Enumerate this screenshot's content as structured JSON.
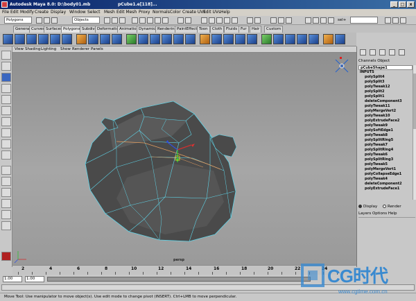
{
  "window": {
    "title": "Autodesk Maya 8.0: D:\\body01.mb",
    "subtitle": "pCube1.e[118]..."
  },
  "menubar": [
    "File",
    "Edit",
    "Modify",
    "Create",
    "Display",
    "Window",
    "Select",
    "Mesh",
    "Edit Mesh",
    "Proxy",
    "Normals",
    "Color",
    "Create UVs",
    "Edit UVs",
    "Help"
  ],
  "statusline": {
    "mode": "Polygons",
    "objects_label": "Objects",
    "sel_label": "sel+"
  },
  "shelf_tabs": [
    "General",
    "Curves",
    "Surfaces",
    "Polygons",
    "Subdivs",
    "Deformation",
    "Animation",
    "Dynamics",
    "Rendering",
    "PaintEffects",
    "Toon",
    "Cloth",
    "Fluids",
    "Fur",
    "Hair",
    "Custom"
  ],
  "active_shelf_tab": "Polygons",
  "panel_menu": [
    "View",
    "Shading",
    "Lighting",
    "Show",
    "Renderer",
    "Panels"
  ],
  "viewport": {
    "camera_label": "persp"
  },
  "channel_box": {
    "menu": "Channels  Object",
    "object": "pCubeShape1",
    "inputs_label": "INPUTS",
    "inputs": [
      "polySplit4",
      "polySplit3",
      "polyTweak12",
      "polySplit2",
      "polySplit1",
      "deleteComponent3",
      "polyTweak11",
      "polyMergeVert2",
      "polyTweak10",
      "polyExtrudeFace2",
      "polyTweak9",
      "polySoftEdge1",
      "polyTweak8",
      "polySplitRing5",
      "polyTweak7",
      "polySplitRing4",
      "polyTweak6",
      "polySplitRing3",
      "polyTweak5",
      "polyMergeVert1",
      "polyCollapseEdge1",
      "polyTweak4",
      "deleteComponent2",
      "polyExtrudeFace1"
    ],
    "layer_display": "Display",
    "layer_render": "Render",
    "layer_menu": "Layers  Options  Help"
  },
  "time_slider": {
    "ticks": [
      "2",
      "4",
      "6",
      "8",
      "10",
      "12",
      "14",
      "16",
      "18",
      "20",
      "22",
      "24"
    ]
  },
  "range": {
    "start": "1.00",
    "current": "1.00"
  },
  "help_line": "Move Tool: Use manipulator to move object(s). Use edit mode to change pivot (INSERT). Ctrl+LMB to move perpendicular.",
  "watermark": {
    "brand": "CG时代",
    "url": "www.cgtime.com.cn"
  },
  "colors": {
    "title_bar": "#0a246a",
    "wireframe_highlight": "#5fd4e8",
    "mesh_fill": "#4a4a4a"
  }
}
